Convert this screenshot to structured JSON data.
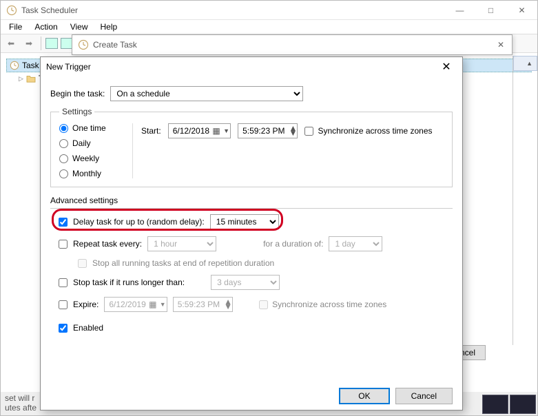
{
  "window": {
    "title": "Task Scheduler",
    "menus": [
      "File",
      "Action",
      "View",
      "Help"
    ],
    "minimize": "—",
    "maximize": "□",
    "close": "✕"
  },
  "sidebar": {
    "root": "Task S",
    "child": "Ta"
  },
  "createTask": {
    "title": "Create Task",
    "close": "✕"
  },
  "background_cancel": "ancel",
  "dialog": {
    "title": "New Trigger",
    "close": "✕",
    "begin_label": "Begin the task:",
    "begin_value": "On a schedule",
    "settings_legend": "Settings",
    "schedule": {
      "options": [
        "One time",
        "Daily",
        "Weekly",
        "Monthly"
      ],
      "selected": "One time"
    },
    "start_label": "Start:",
    "start_date": "6/12/2018",
    "start_time": "5:59:23 PM",
    "sync_tz_label": "Synchronize across time zones",
    "advanced_legend": "Advanced settings",
    "delay": {
      "checked": true,
      "label": "Delay task for up to (random delay):",
      "value": "15 minutes"
    },
    "repeat": {
      "checked": false,
      "label": "Repeat task every:",
      "interval": "1 hour",
      "duration_label": "for a duration of:",
      "duration": "1 day"
    },
    "stop_all_label": "Stop all running tasks at end of repetition duration",
    "stop_if": {
      "checked": false,
      "label": "Stop task if it runs longer than:",
      "value": "3 days"
    },
    "expire": {
      "checked": false,
      "label": "Expire:",
      "date": "6/12/2019",
      "time": "5:59:23 PM",
      "sync_label": "Synchronize across time zones"
    },
    "enabled": {
      "checked": true,
      "label": "Enabled"
    },
    "ok": "OK",
    "cancel": "Cancel"
  },
  "bottom_text": "set will r\nutes afte"
}
